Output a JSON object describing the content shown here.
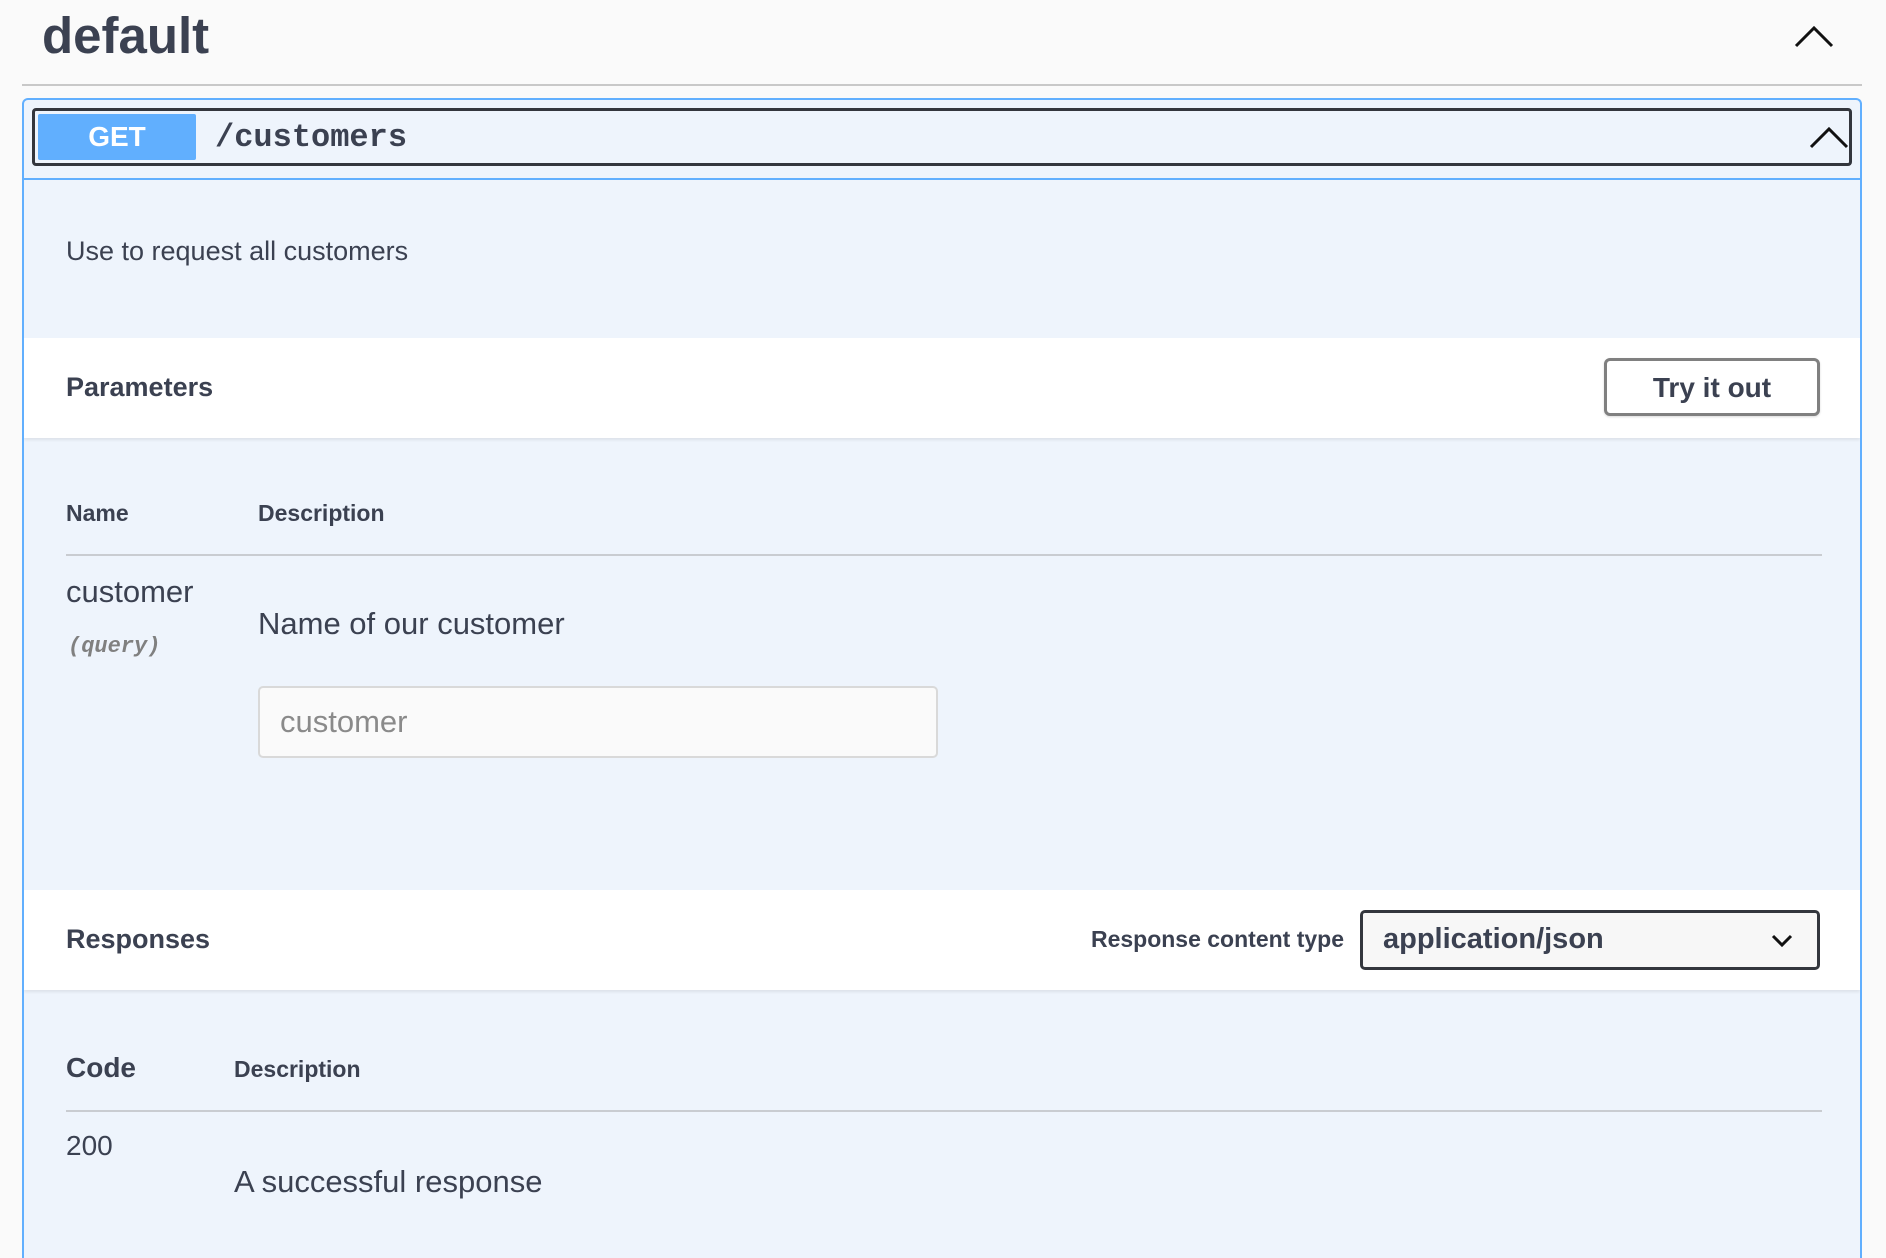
{
  "section": {
    "title": "default"
  },
  "operation": {
    "method": "GET",
    "path": "/customers",
    "description": "Use to request all customers"
  },
  "parameters": {
    "title": "Parameters",
    "try_button_label": "Try it out",
    "columns": [
      "Name",
      "Description"
    ],
    "items": [
      {
        "name": "customer",
        "in": "(query)",
        "description": "Name of our customer",
        "input_placeholder": "customer"
      }
    ]
  },
  "responses": {
    "title": "Responses",
    "content_type_label": "Response content type",
    "content_type_value": "application/json",
    "columns": [
      "Code",
      "Description"
    ],
    "items": [
      {
        "code": "200",
        "description": "A successful response"
      }
    ]
  },
  "colors": {
    "get_method": "#61affe",
    "block_background": "#eef4fc",
    "text": "#3b4151"
  },
  "icons": {
    "section_toggle": "chevron-up-icon",
    "summary_toggle": "chevron-up-icon",
    "select_arrow": "chevron-down-icon"
  }
}
